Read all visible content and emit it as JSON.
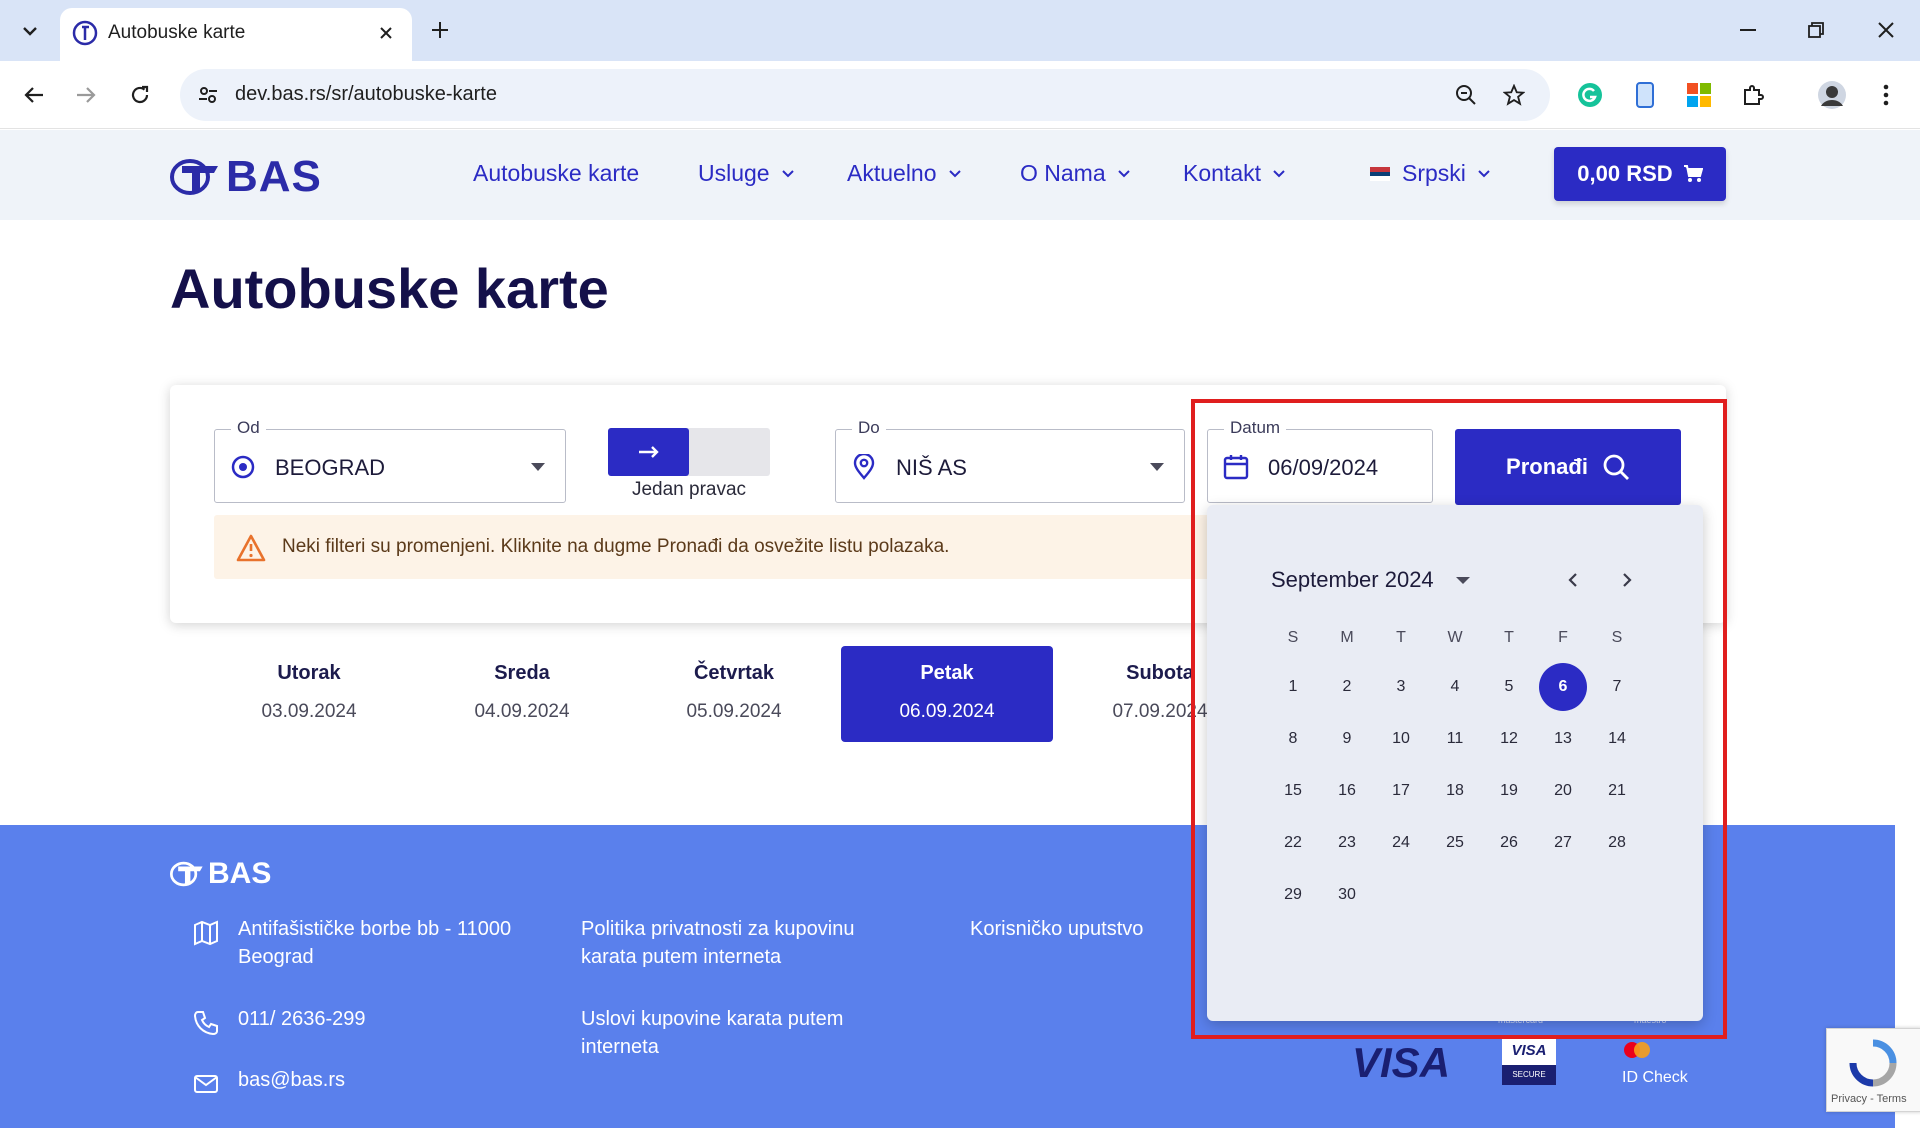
{
  "browser": {
    "tab_title": "Autobuske karte",
    "url": "dev.bas.rs/sr/autobuske-karte"
  },
  "header": {
    "logo_text": "BAS",
    "nav": [
      "Autobuske karte",
      "Usluge",
      "Aktuelno",
      "O Nama",
      "Kontakt"
    ],
    "language": "Srpski",
    "cart": "0,00 RSD"
  },
  "page": {
    "title": "Autobuske karte"
  },
  "search": {
    "from_label": "Od",
    "from_value": "BEOGRAD",
    "trip_type": "Jedan pravac",
    "to_label": "Do",
    "to_value": "NIŠ AS",
    "date_label": "Datum",
    "date_value": "06/09/2024",
    "find_label": "Pronađi",
    "alert": "Neki filteri su promenjeni. Kliknite na dugme Pronađi da osvežite listu polazaka."
  },
  "days": [
    {
      "name": "Utorak",
      "date": "03.09.2024"
    },
    {
      "name": "Sreda",
      "date": "04.09.2024"
    },
    {
      "name": "Četvrtak",
      "date": "05.09.2024"
    },
    {
      "name": "Petak",
      "date": "06.09.2024"
    },
    {
      "name": "Subota",
      "date": "07.09.2024"
    }
  ],
  "datepicker": {
    "month": "September 2024",
    "weekdays": [
      "S",
      "M",
      "T",
      "W",
      "T",
      "F",
      "S"
    ],
    "selected": 6,
    "first_weekday_index": 0,
    "days_in_month": 30
  },
  "footer": {
    "logo_text": "BAS",
    "address": "Antifašističke borbe bb - 11000 Beograd",
    "phone": "011/ 2636-299",
    "email": "bas@bas.rs",
    "link_privacy": "Politika privatnosti za kupovinu karata putem interneta",
    "link_terms": "Uslovi kupovine karata putem interneta",
    "link_manual": "Korisničko uputstvo",
    "pay_visa": "VISA",
    "pay_visa_secure": "VISA",
    "pay_visa_secure_sub": "SECURE",
    "pay_idcheck": "ID Check",
    "pay_mastercard_partial": "mastercard",
    "pay_maestro_partial": "maestro"
  },
  "recaptcha": {
    "text": "Privacy - Terms"
  },
  "colors": {
    "brand": "#2b2bc4",
    "footer": "#5a80ec",
    "highlight": "#e01e1e"
  }
}
